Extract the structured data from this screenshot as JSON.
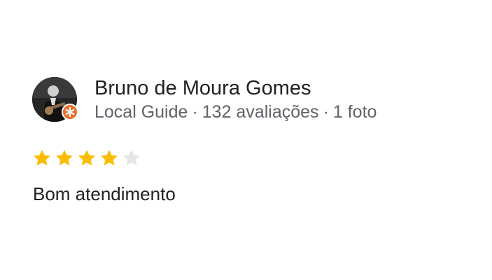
{
  "review": {
    "reviewer_name": "Bruno de Moura Gomes",
    "reviewer_level": "Local Guide",
    "reviews_count": "132 avaliações",
    "photos_count": "1 foto",
    "separator": "·",
    "rating": 4,
    "rating_max": 5,
    "text": "Bom atendimento",
    "avatar_icon": "reviewer-photo",
    "badge_icon": "local-guide-star-icon",
    "colors": {
      "star_filled": "#fbbc04",
      "star_empty": "#e6e6e6",
      "badge": "#e8702a",
      "name": "#202124",
      "meta": "#5f6368"
    }
  }
}
